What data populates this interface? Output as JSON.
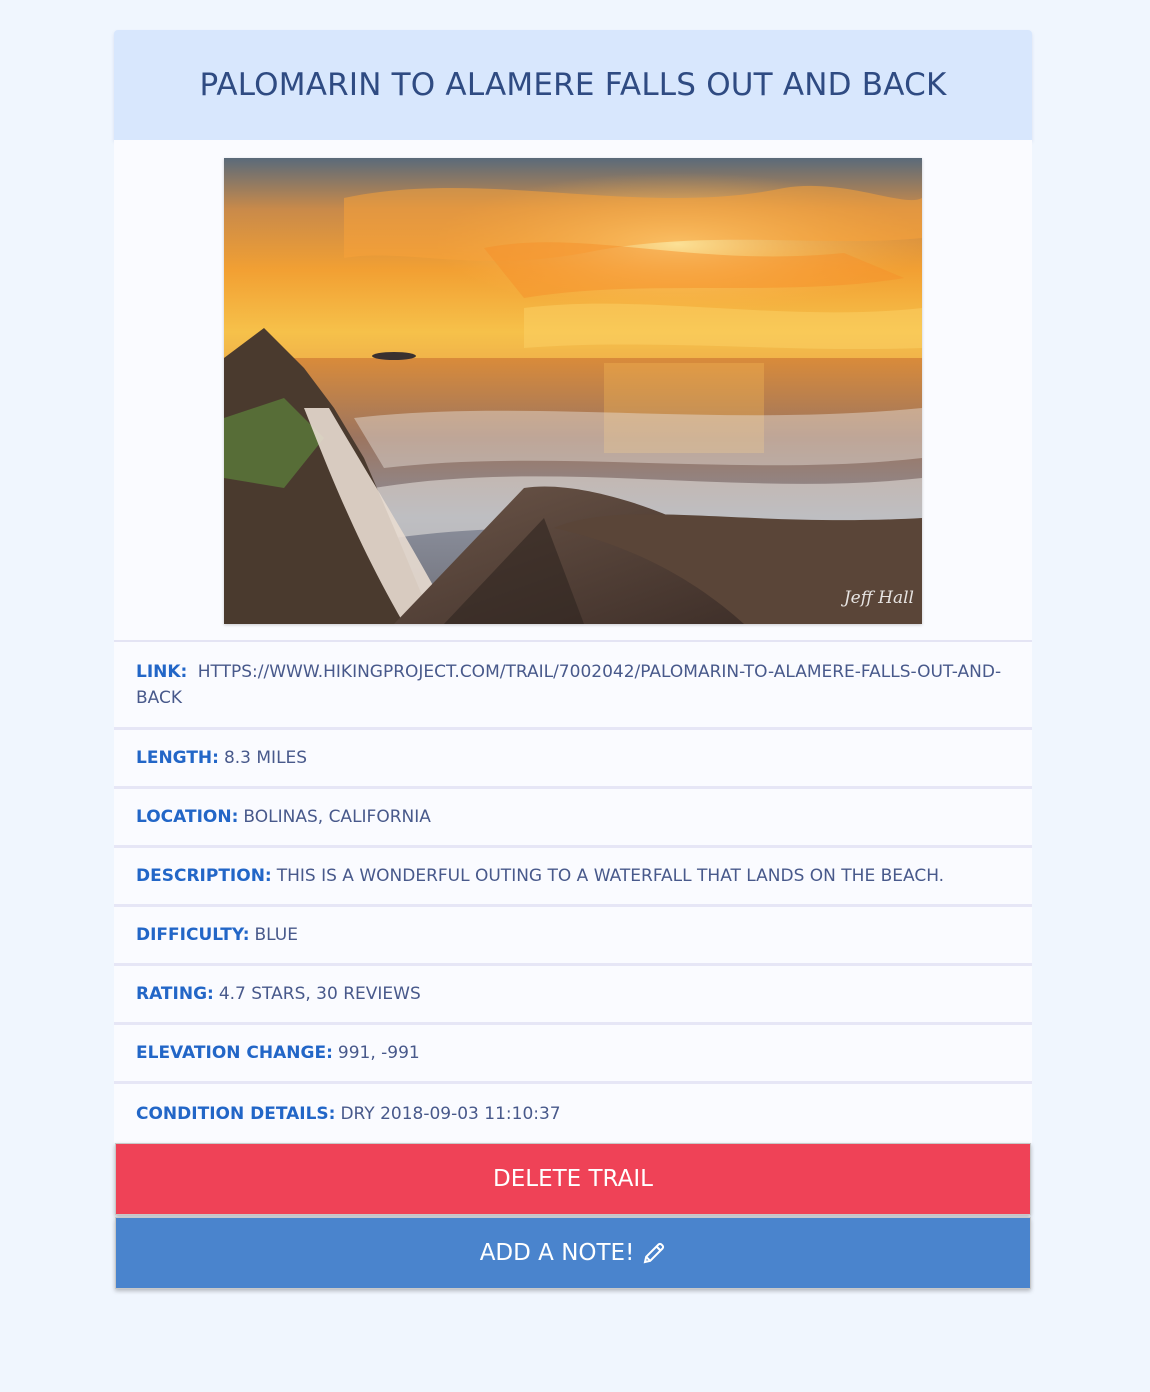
{
  "trail": {
    "title": "PALOMARIN TO ALAMERE FALLS OUT AND BACK",
    "image_alt": "coastal waterfall sunset photo",
    "watermark": "Jeff Hall",
    "fields": [
      {
        "label": "LINK:",
        "value": "HTTPS://WWW.HIKINGPROJECT.COM/TRAIL/7002042/PALOMARIN-TO-ALAMERE-FALLS-OUT-AND-BACK"
      },
      {
        "label": "LENGTH:",
        "value": "8.3 MILES"
      },
      {
        "label": "LOCATION:",
        "value": "BOLINAS, CALIFORNIA"
      },
      {
        "label": "DESCRIPTION:",
        "value": "THIS IS A WONDERFUL OUTING TO A WATERFALL THAT LANDS ON THE BEACH."
      },
      {
        "label": "DIFFICULTY:",
        "value": "BLUE"
      },
      {
        "label": "RATING:",
        "value": "4.7 STARS, 30 REVIEWS"
      },
      {
        "label": "ELEVATION CHANGE:",
        "value": "991, -991"
      },
      {
        "label": "CONDITION DETAILS:",
        "value": "DRY 2018-09-03 11:10:37"
      }
    ]
  },
  "actions": {
    "delete_label": "DELETE TRAIL",
    "note_label": "ADD A NOTE!",
    "note_icon": "pencil-icon"
  },
  "colors": {
    "header_bg": "#d8e7fd",
    "label": "#2266c7",
    "delete": "#ef4257",
    "note": "#4a84cd"
  }
}
